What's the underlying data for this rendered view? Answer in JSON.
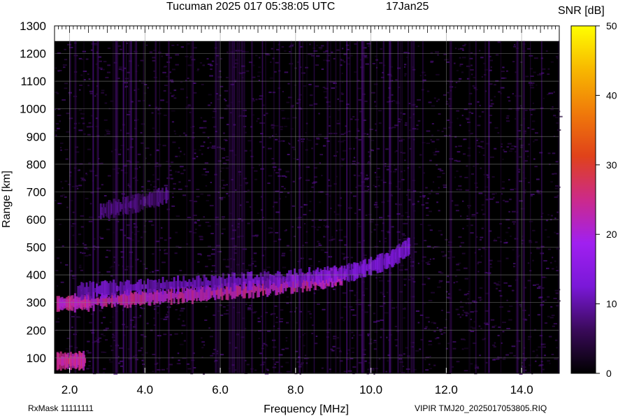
{
  "chart_data": {
    "type": "heatmap",
    "title": "Tucuman 2025 017 05:38:05 UTC",
    "date_label": "17Jan25",
    "xlabel": "Frequency [MHz]",
    "ylabel": "Range [km]",
    "colorbar_label": "SNR [dB]",
    "xlim": [
      1.6,
      15.0
    ],
    "ylim": [
      44,
      1300
    ],
    "data_ylim_top": 1245,
    "x_ticks": [
      2.0,
      4.0,
      6.0,
      8.0,
      10.0,
      12.0,
      14.0
    ],
    "x_tick_labels": [
      "2.0",
      "4.0",
      "6.0",
      "8.0",
      "10.0",
      "12.0",
      "14.0"
    ],
    "y_ticks": [
      100,
      200,
      300,
      400,
      500,
      600,
      700,
      800,
      900,
      1000,
      1100,
      1200,
      1300
    ],
    "y_tick_labels": [
      "100",
      "200",
      "300",
      "400",
      "500",
      "600",
      "700",
      "800",
      "900",
      "1000",
      "1100",
      "1200",
      "1300"
    ],
    "colorbar_range": [
      0,
      50
    ],
    "colorbar_ticks": [
      0,
      10,
      20,
      30,
      40,
      50
    ],
    "colorbar_tick_labels": [
      "0",
      "10",
      "20",
      "30",
      "40",
      "50"
    ],
    "colormap": [
      "#000000",
      "#3a0a5a",
      "#7a18d8",
      "#a020f0",
      "#cc2a8a",
      "#e0421a",
      "#f07a0a",
      "#f8b800",
      "#ffff00"
    ],
    "grid": true,
    "background": "#000000",
    "traces": [
      {
        "name": "F-layer O-mode trace",
        "freq_mhz": [
          1.65,
          2.5,
          4.0,
          5.5,
          7.0,
          8.5,
          9.3
        ],
        "range_km": [
          295,
          302,
          318,
          332,
          350,
          378,
          398
        ],
        "snr_db": 24
      },
      {
        "name": "F-layer X-mode trace",
        "freq_mhz": [
          2.2,
          4.0,
          6.0,
          8.0,
          9.5,
          10.5,
          11.0
        ],
        "range_km": [
          340,
          358,
          372,
          388,
          410,
          455,
          505
        ],
        "snr_db": 13
      },
      {
        "name": "Second-hop trace",
        "freq_mhz": [
          2.8,
          3.8,
          4.6
        ],
        "range_km": [
          630,
          660,
          690
        ],
        "snr_db": 8
      },
      {
        "name": "Sporadic E trace",
        "freq_mhz": [
          1.65,
          2.4
        ],
        "range_km": [
          88,
          90
        ],
        "snr_db": 25
      }
    ]
  },
  "footer": {
    "rxmask": "RxMask 11111111",
    "file_id": "VIPIR  TMJ20_2025017053805.RIQ"
  }
}
